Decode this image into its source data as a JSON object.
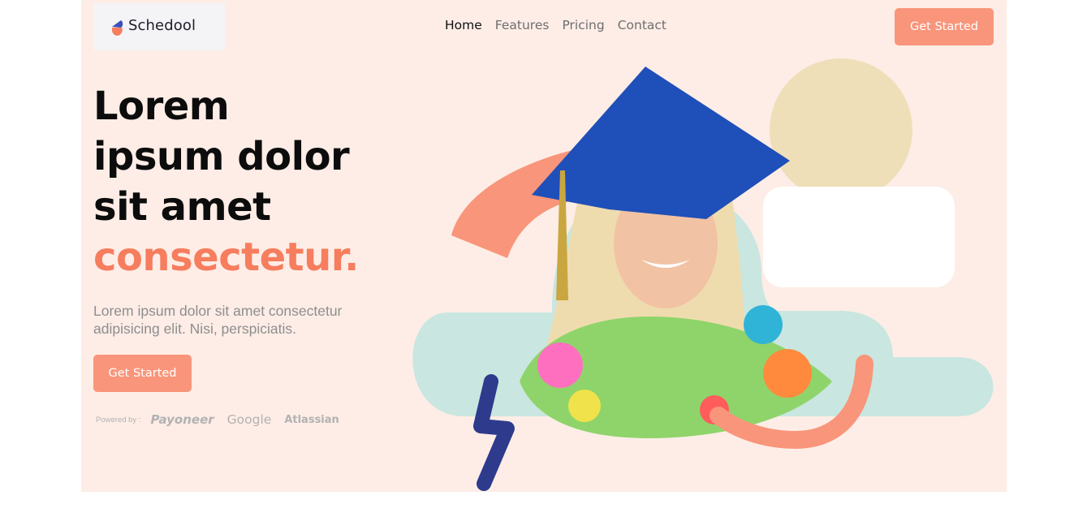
{
  "brand": {
    "name": "Schedool"
  },
  "nav": {
    "items": [
      {
        "label": "Home",
        "active": true
      },
      {
        "label": "Features",
        "active": false
      },
      {
        "label": "Pricing",
        "active": false
      },
      {
        "label": "Contact",
        "active": false
      }
    ]
  },
  "header": {
    "cta_label": "Get Started"
  },
  "hero": {
    "headline_lines": [
      "Lorem",
      "ipsum dolor",
      "sit amet"
    ],
    "headline_accent": "consectetur.",
    "subtext": "Lorem ipsum dolor sit amet consectetur adipisicing elit. Nisi, perspiciatis.",
    "cta_label": "Get Started"
  },
  "powered_by": {
    "label": "Powered by :",
    "brands": [
      "Payoneer",
      "Google",
      "Atlassian"
    ]
  },
  "colors": {
    "page_bg": "#fdede6",
    "accent": "#f9957a",
    "headline_accent": "#f67d5e",
    "mint_shape": "#c9e6e0",
    "sand_circle": "#efdfb8",
    "cap_blue": "#1f4fb8",
    "bolt_navy": "#2e3a8c"
  },
  "icons": {
    "logo": "schedool-logo-icon",
    "bolt": "lightning-bolt-icon"
  }
}
